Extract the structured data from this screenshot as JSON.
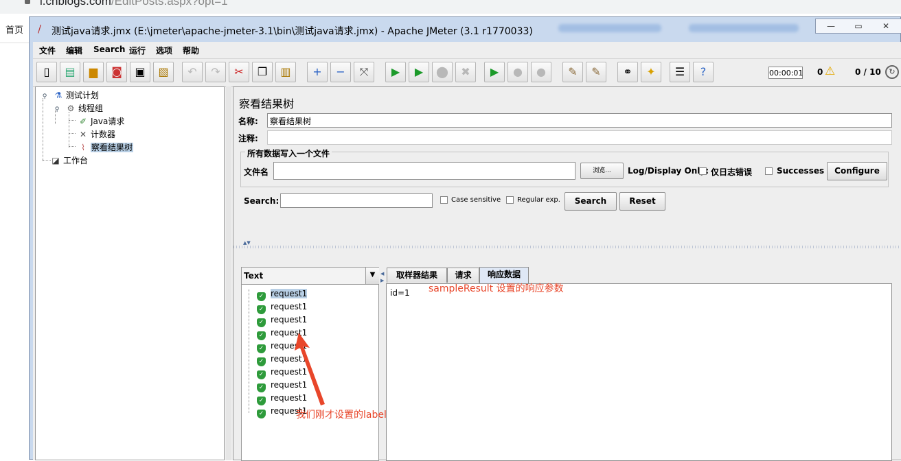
{
  "browser": {
    "url_host": "i.cnblogs.com",
    "url_path": "/EditPosts.aspx?opt=1",
    "home_label": "首页"
  },
  "window": {
    "title": "测试java请求.jmx (E:\\jmeter\\apache-jmeter-3.1\\bin\\测试java请求.jmx) - Apache JMeter (3.1 r1770033)"
  },
  "menu": [
    "文件",
    "编辑",
    "Search",
    "运行",
    "选项",
    "帮助"
  ],
  "toolbar": {
    "elapsed": "00:00:01",
    "errors": "0",
    "threads": "0 / 10"
  },
  "tree": {
    "test_plan": "测试计划",
    "thread_group": "线程组",
    "java_request": "Java请求",
    "counter": "计数器",
    "results_tree": "察看结果树",
    "workbench": "工作台"
  },
  "panel": {
    "title": "察看结果树",
    "name_label": "名称:",
    "name_value": "察看结果树",
    "comment_label": "注释:",
    "group_title": "所有数据写入一个文件",
    "filename_label": "文件名",
    "browse_button": "浏览...",
    "log_display_label": "Log/Display Only:",
    "errors_only_label": "仅日志错误",
    "successes_label": "Successes",
    "configure_button": "Configure",
    "search_label": "Search:",
    "case_sensitive_label": "Case sensitive",
    "regex_label": "Regular exp.",
    "search_button": "Search",
    "reset_button": "Reset"
  },
  "results": {
    "renderer": "Text",
    "items": [
      "request1",
      "request1",
      "request1",
      "request1",
      "request1",
      "request1",
      "request1",
      "request1",
      "request1",
      "request1"
    ]
  },
  "tabs": [
    "取样器结果",
    "请求",
    "响应数据"
  ],
  "response_text": "id=1",
  "annotations": {
    "response_note": "sampleResult 设置的响应参数",
    "label_note": "我们刚才设置的label"
  },
  "colors": {
    "annotation": "#e8462a",
    "success_icon": "#2e9b3b",
    "selection": "#b8cfe5"
  }
}
